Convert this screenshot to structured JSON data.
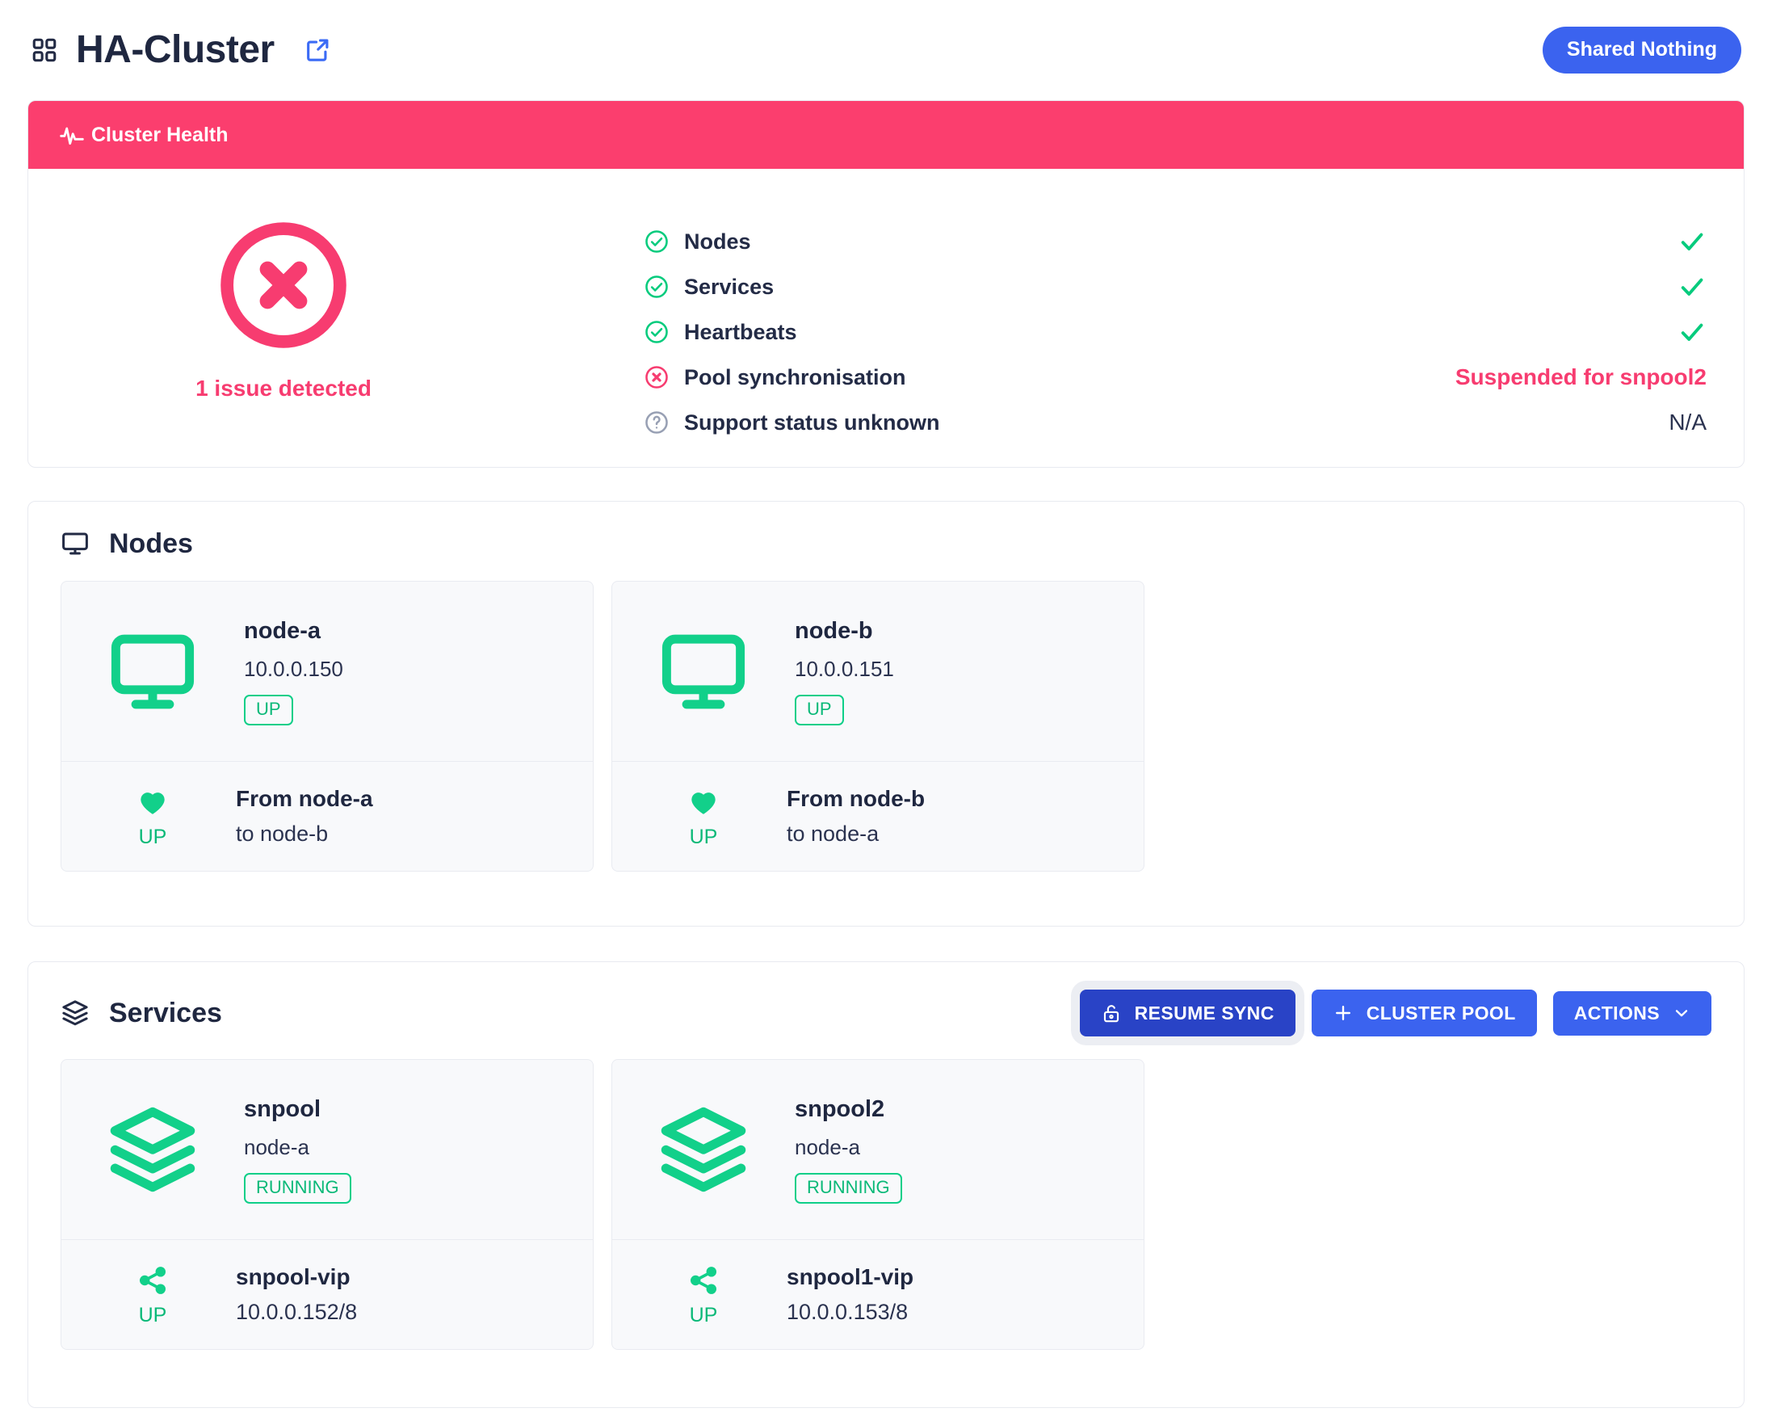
{
  "header": {
    "title": "HA-Cluster",
    "grid_icon": "grid-icon",
    "external_link_icon": "external-link-icon",
    "badge": "Shared Nothing",
    "badge_color": "#3b63ef"
  },
  "health": {
    "banner_title": "Cluster Health",
    "banner_icon": "pulse-icon",
    "banner_color": "#fb3e6e",
    "summary_icon": "x-circle-icon",
    "summary_text": "1 issue detected",
    "summary_color": "#f73c70",
    "checks": [
      {
        "label": "Nodes",
        "icon": "check-circle-icon",
        "status": "ok",
        "value": ""
      },
      {
        "label": "Services",
        "icon": "check-circle-icon",
        "status": "ok",
        "value": ""
      },
      {
        "label": "Heartbeats",
        "icon": "check-circle-icon",
        "status": "ok",
        "value": ""
      },
      {
        "label": "Pool synchronisation",
        "icon": "x-circle-small-icon",
        "status": "error",
        "value": "Suspended for snpool2"
      },
      {
        "label": "Support status unknown",
        "icon": "question-circle-icon",
        "status": "unknown",
        "value": "N/A"
      }
    ]
  },
  "nodes": {
    "section_title": "Nodes",
    "section_icon": "monitor-icon",
    "cards": [
      {
        "icon": "monitor-icon",
        "name": "node-a",
        "address": "10.0.0.150",
        "state": "UP",
        "foot": {
          "icon": "heart-icon",
          "state": "UP",
          "title": "From node-a",
          "sub": "to node-b"
        }
      },
      {
        "icon": "monitor-icon",
        "name": "node-b",
        "address": "10.0.0.151",
        "state": "UP",
        "foot": {
          "icon": "heart-icon",
          "state": "UP",
          "title": "From node-b",
          "sub": "to node-a"
        }
      }
    ]
  },
  "services": {
    "section_title": "Services",
    "section_icon": "layers-icon",
    "buttons": [
      {
        "label": "RESUME SYNC",
        "icon": "unlock-icon",
        "focused": true
      },
      {
        "label": "CLUSTER POOL",
        "icon": "plus-icon",
        "focused": false
      },
      {
        "label": "ACTIONS",
        "icon": "chevron-down-icon",
        "focused": false
      }
    ],
    "cards": [
      {
        "icon": "layers-icon",
        "name": "snpool",
        "node": "node-a",
        "state": "RUNNING",
        "foot": {
          "icon": "share-icon",
          "state": "UP",
          "title": "snpool-vip",
          "sub": "10.0.0.152/8"
        }
      },
      {
        "icon": "layers-icon",
        "name": "snpool2",
        "node": "node-a",
        "state": "RUNNING",
        "foot": {
          "icon": "share-icon",
          "state": "UP",
          "title": "snpool1-vip",
          "sub": "10.0.0.153/8"
        }
      }
    ]
  },
  "colors": {
    "accent_blue": "#3b63ef",
    "accent_blue_dark": "#2943c6",
    "danger_pink": "#fb3e6e",
    "success_green": "#12d08a",
    "text_dark": "#1f2740",
    "card_bg": "#f8f9fb",
    "border": "#e8eaf0"
  }
}
